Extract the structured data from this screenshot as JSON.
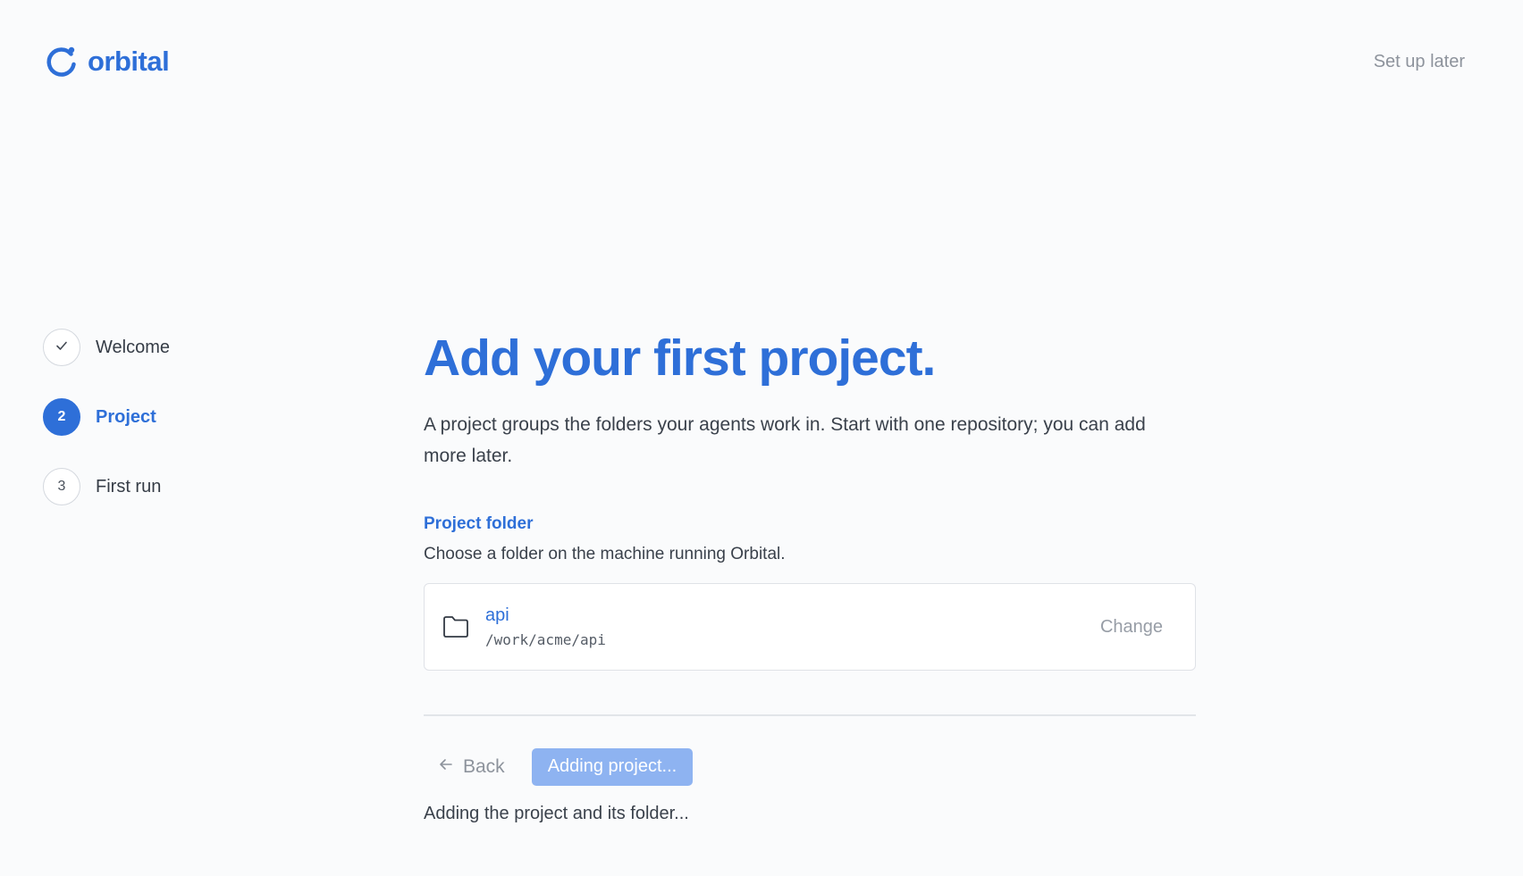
{
  "brand": {
    "name": "orbital"
  },
  "header": {
    "setup_later": "Set up later"
  },
  "steps": [
    {
      "label": "Welcome",
      "marker": "",
      "state": "done"
    },
    {
      "label": "Project",
      "marker": "2",
      "state": "active"
    },
    {
      "label": "First run",
      "marker": "3",
      "state": "upcoming"
    }
  ],
  "main": {
    "title": "Add your first project.",
    "description": "A project groups the folders your agents work in. Start with one repository; you can add more later.",
    "field": {
      "label": "Project folder",
      "help": "Choose a folder on the machine running Orbital.",
      "folder_name": "api",
      "folder_path": "/work/acme/api",
      "change_label": "Change"
    },
    "actions": {
      "back_label": "Back",
      "primary_label": "Adding project..."
    },
    "status": "Adding the project and its folder..."
  },
  "colors": {
    "accent": "#2e6fd8",
    "accent_disabled": "#8eb3f1",
    "muted": "#8d939c"
  },
  "icons": {
    "logo": "orbital-logo-icon",
    "step_done": "check-icon",
    "folder": "folder-icon",
    "back": "arrow-left-icon"
  }
}
